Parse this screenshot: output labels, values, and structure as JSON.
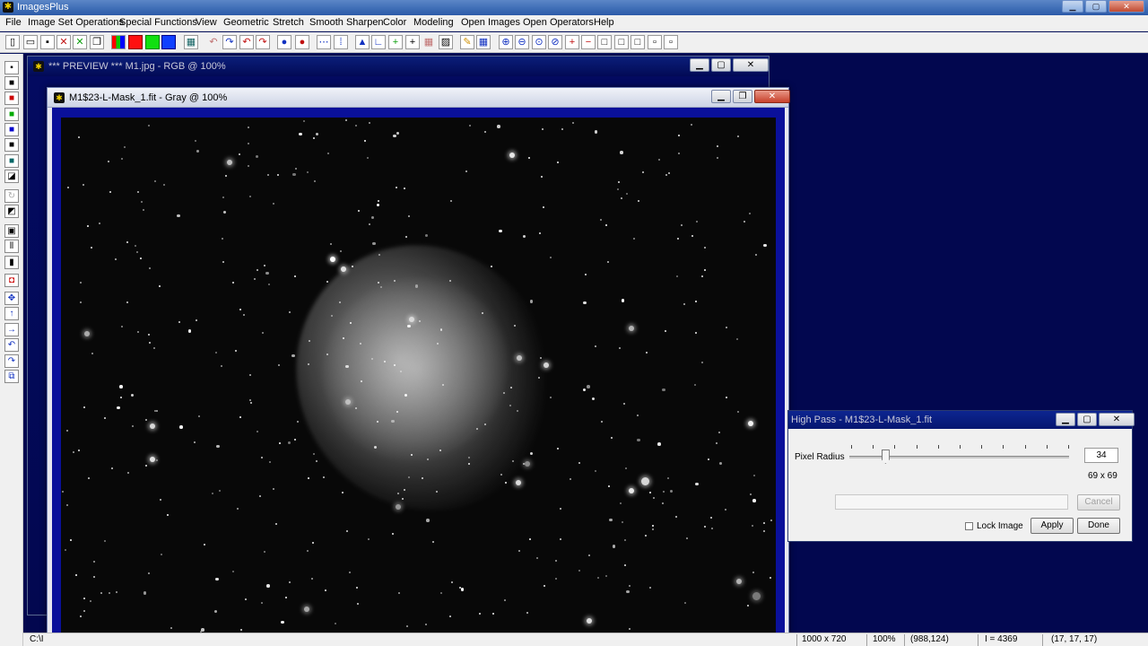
{
  "app": {
    "title": "ImagesPlus"
  },
  "menu": [
    "File",
    "Image Set Operations",
    "Special Functions",
    "View",
    "Geometric",
    "Stretch",
    "Smooth Sharpen",
    "Color",
    "Modeling",
    "Open Images",
    "Open Operators",
    "Help"
  ],
  "preview_window": {
    "title": "*** PREVIEW *** M1.jpg - RGB @ 100%"
  },
  "image_window": {
    "title": "M1$23-L-Mask_1.fit - Gray @ 100%"
  },
  "high_pass": {
    "title": "High Pass - M1$23-L-Mask_1.fit",
    "pixel_radius_label": "Pixel Radius",
    "pixel_radius_value": "34",
    "kernel_size": "69 x 69",
    "slider_fraction": 0.14,
    "cancel_label": "Cancel",
    "lock_image_label": "Lock Image",
    "apply_label": "Apply",
    "done_label": "Done"
  },
  "status": {
    "path": "C:\\I",
    "dimensions": "1000 x 720",
    "zoom": "100%",
    "cursor": "(988,124)",
    "intensity": "I = 4369",
    "rgb": "(17, 17, 17)"
  },
  "colors": {
    "mdi_background": "#02074f",
    "image_frame": "#0a109a",
    "dialog_title": "#0d2590"
  }
}
